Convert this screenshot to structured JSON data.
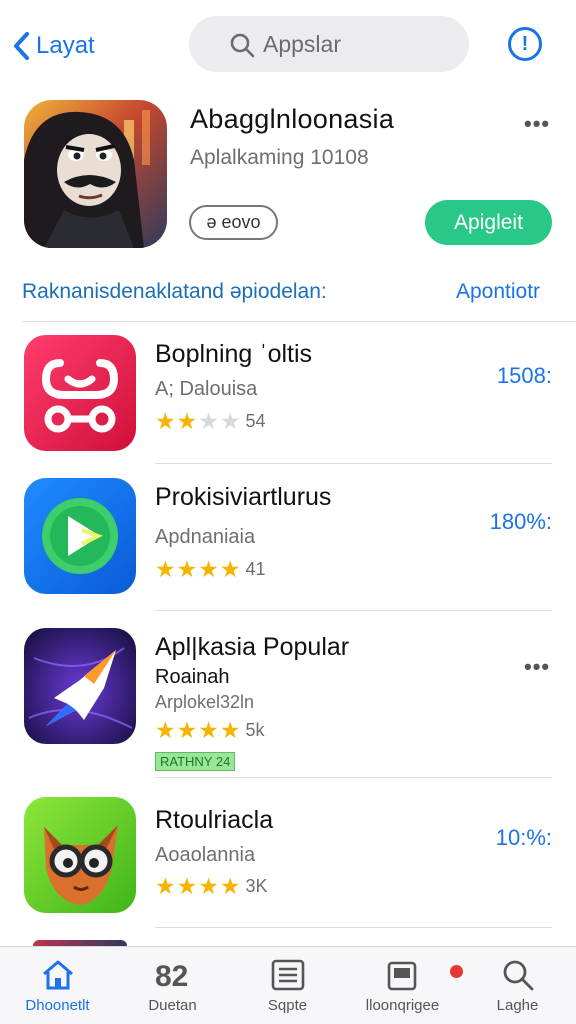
{
  "header": {
    "back_label": "Layat",
    "search_placeholder": "Appslar"
  },
  "featured": {
    "title": "Abagglnloonasia",
    "subtitle": "Aplalkaming 10108",
    "pill_label": "ə eovo",
    "get_label": "Apigleit",
    "more_label": "•••"
  },
  "section": {
    "title": "Raknanisdenaklatand əpiodelan:",
    "link": "Apontiotr"
  },
  "apps": [
    {
      "name": "Boplning ˈoltis",
      "category": "A; Dalouisa",
      "rating": 2,
      "count": "54",
      "price": "1508:"
    },
    {
      "name": "Prokisiviartlurus",
      "category": "Apdnaniaia",
      "rating": 4,
      "count": "41",
      "price": "180%:"
    },
    {
      "name": "Apl|kasia Popular",
      "category": "Roainah",
      "subtitle": "Arplokel32ln",
      "rating": 4,
      "count": "5k",
      "badge": "RATHNY 24",
      "more_label": "•••"
    },
    {
      "name": "Rtoulriacla",
      "category": "Aoaolannia",
      "rating": 4,
      "count": "3K",
      "price": "10:%:"
    }
  ],
  "tabbar": {
    "tabs": [
      {
        "label": "Dhoonetlt",
        "icon": "home-icon",
        "active": true
      },
      {
        "label": "Duetan",
        "icon": "games-icon",
        "active": false
      },
      {
        "label": "Sqpte",
        "icon": "list-icon",
        "active": false
      },
      {
        "label": "lloonqrigee",
        "icon": "updates-icon",
        "active": false,
        "notification": true
      },
      {
        "label": "Laghe",
        "icon": "search-icon",
        "active": false
      }
    ]
  },
  "colors": {
    "accent": "#1a73e8",
    "get_button": "#29c788",
    "star": "#f5b400"
  }
}
